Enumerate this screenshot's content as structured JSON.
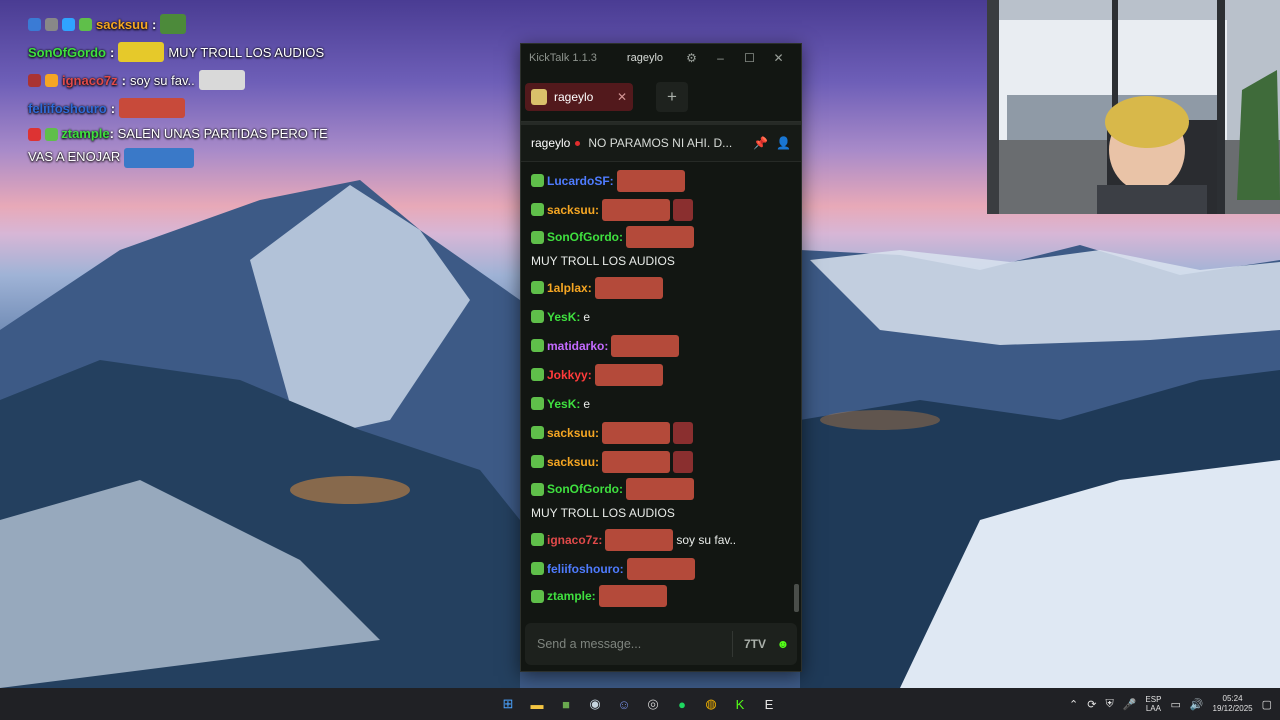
{
  "overlay": {
    "lines": [
      {
        "name": "sacksuu",
        "name_color": "#f5a623",
        "message": ""
      },
      {
        "name": "SonOfGordo",
        "name_color": "#3fe03f",
        "message": "MUY TROLL LOS AUDIOS"
      },
      {
        "name": "ignaco7z",
        "name_color": "#e04a4a",
        "message": "soy su fav.."
      },
      {
        "name": "feliifoshouro",
        "name_color": "#2f6bd8",
        "message": ""
      },
      {
        "name": "ztample",
        "name_color": "#3fe03f",
        "message": "SALEN UNAS PARTIDAS PERO TE VAS A ENOJAR"
      }
    ]
  },
  "kicktalk": {
    "app_title": "KickTalk 1.1.3",
    "current_user": "rageylo",
    "tab_label": "rageylo",
    "add_tab_label": "+",
    "pinned": {
      "name": "rageylo",
      "text": "NO PARAMOS NI AHI. D..."
    },
    "input_placeholder": "Send a message...",
    "emote_button_label": "7TV",
    "messages": [
      {
        "name": "LucardoSF:",
        "color": "#4f7cff",
        "text": "",
        "emote": true,
        "emote2": false
      },
      {
        "name": "sacksuu:",
        "color": "#f5a623",
        "text": "",
        "emote": true,
        "emote2": true
      },
      {
        "name": "SonOfGordo:",
        "color": "#3fe03f",
        "text": "MUY TROLL LOS AUDIOS",
        "emote": true,
        "emote2": false
      },
      {
        "name": "1alplax:",
        "color": "#f5a623",
        "text": "",
        "emote": true,
        "emote2": false
      },
      {
        "name": "YesK:",
        "color": "#3fe03f",
        "text": "e",
        "emote": false,
        "emote2": false
      },
      {
        "name": "matidarko:",
        "color": "#c46bff",
        "text": "",
        "emote": true,
        "emote2": false
      },
      {
        "name": "Jokkyy:",
        "color": "#ff3b3b",
        "text": "",
        "emote": true,
        "emote2": false
      },
      {
        "name": "YesK:",
        "color": "#3fe03f",
        "text": "e",
        "emote": false,
        "emote2": false
      },
      {
        "name": "sacksuu:",
        "color": "#f5a623",
        "text": "",
        "emote": true,
        "emote2": true
      },
      {
        "name": "sacksuu:",
        "color": "#f5a623",
        "text": "",
        "emote": true,
        "emote2": true
      },
      {
        "name": "SonOfGordo:",
        "color": "#3fe03f",
        "text": "MUY TROLL LOS AUDIOS",
        "emote": true,
        "emote2": false
      },
      {
        "name": "ignaco7z:",
        "color": "#e04a4a",
        "text": "soy su fav..",
        "emote": true,
        "emote2": false
      },
      {
        "name": "feliifoshouro:",
        "color": "#4f7cff",
        "text": "",
        "emote": true,
        "emote2": false
      },
      {
        "name": "ztample:",
        "color": "#3fe03f",
        "text": "SALEN UNAS PARTIDAS PERO TE VAS A ENOJAR",
        "emote": true,
        "emote2": false
      }
    ]
  },
  "taskbar": {
    "apps": [
      {
        "name": "start-icon",
        "glyph": "⊞",
        "color": "#4aa3ff"
      },
      {
        "name": "file-explorer-icon",
        "glyph": "▬",
        "color": "#f4c542"
      },
      {
        "name": "minecraft-icon",
        "glyph": "■",
        "color": "#6aa84f"
      },
      {
        "name": "steam-icon",
        "glyph": "◉",
        "color": "#c7d5e0"
      },
      {
        "name": "discord-icon",
        "glyph": "☺",
        "color": "#7289da"
      },
      {
        "name": "obs-icon",
        "glyph": "◎",
        "color": "#d0d0d0"
      },
      {
        "name": "spotify-icon",
        "glyph": "●",
        "color": "#1ed760"
      },
      {
        "name": "chrome-icon",
        "glyph": "◍",
        "color": "#f4b400"
      },
      {
        "name": "kick-icon",
        "glyph": "K",
        "color": "#53fc18"
      },
      {
        "name": "epic-games-icon",
        "glyph": "E",
        "color": "#e6e6e6"
      }
    ],
    "language": "ESP",
    "language_sub": "LAA",
    "time": "05:24",
    "date": "19/12/2025"
  }
}
